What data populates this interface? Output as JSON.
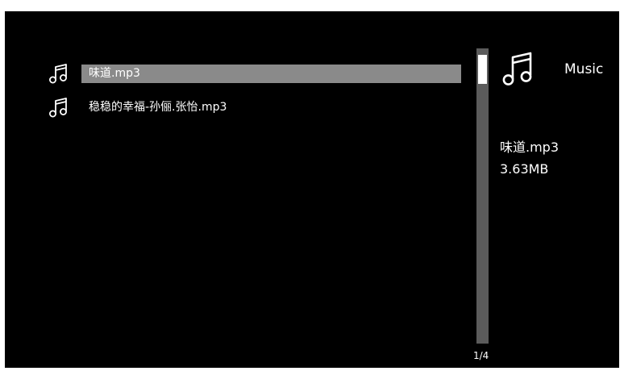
{
  "file_list": {
    "items": [
      {
        "name": "味道.mp3",
        "icon": "music-note-icon",
        "selected": true
      },
      {
        "name": "稳稳的幸福-孙俪.张怡.mp3",
        "icon": "music-note-icon",
        "selected": false
      }
    ]
  },
  "pagination": {
    "indicator": "1/4"
  },
  "info_panel": {
    "icon": "music-note-icon",
    "category_label": "Music",
    "file_name": "味道.mp3",
    "file_size": "3.63MB"
  },
  "colors": {
    "background": "#000000",
    "highlight": "#8a8a8a",
    "scrollbar_track": "#5b5b5b",
    "scrollbar_thumb": "#ffffff",
    "text": "#ffffff"
  }
}
